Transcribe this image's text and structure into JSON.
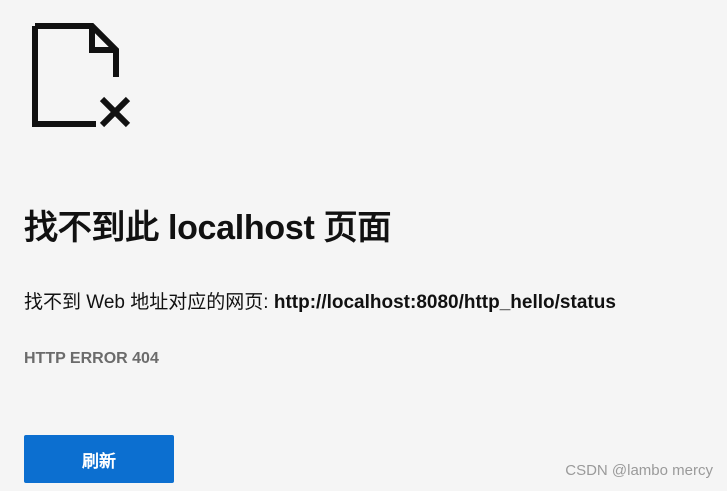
{
  "icon": {
    "name": "file-not-found-icon",
    "color": "#111111"
  },
  "main": {
    "title": "找不到此 localhost 页面",
    "description_prefix": "找不到 Web 地址对应的网页: ",
    "description_url": "http://localhost:8080/http_hello/status",
    "error_code": "HTTP ERROR 404",
    "refresh_label": "刷新"
  },
  "watermark": {
    "text": "CSDN @lambo mercy"
  },
  "colors": {
    "background": "#f5f5f5",
    "button": "#0c6fd0",
    "button_text": "#ffffff",
    "error_code": "#6b6b6b"
  }
}
